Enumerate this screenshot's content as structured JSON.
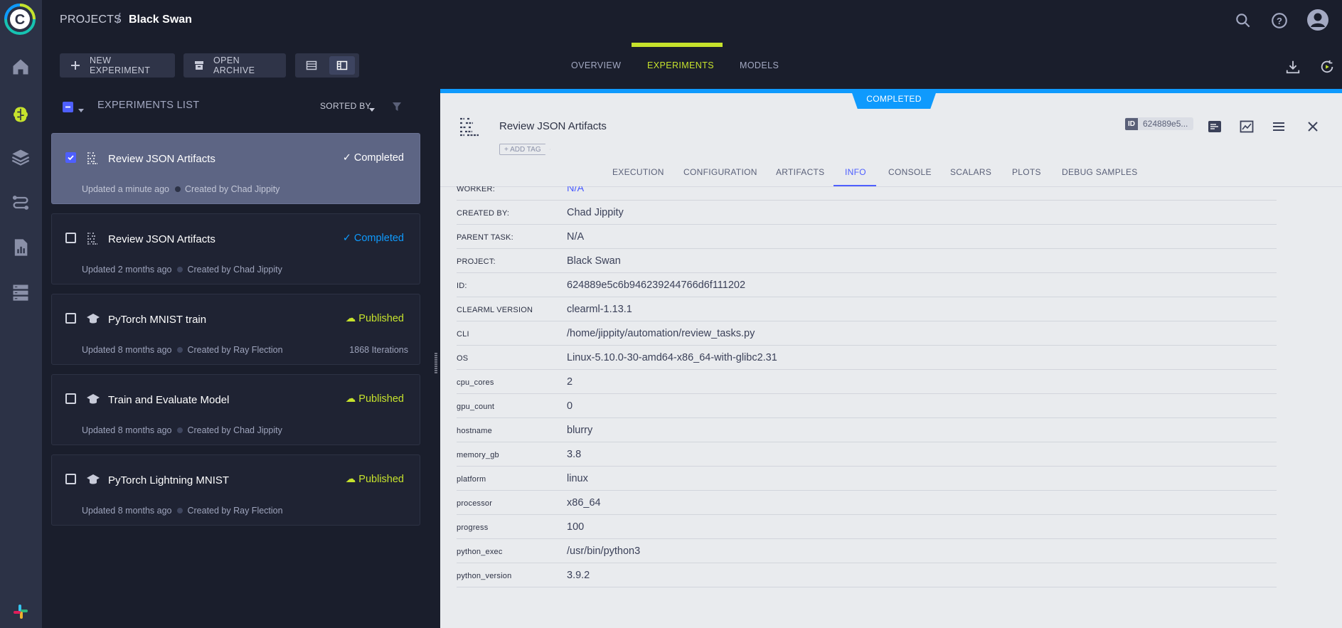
{
  "breadcrumb": {
    "projects": "PROJECTS",
    "separator": "/",
    "project": "Black Swan"
  },
  "toolbar": {
    "new_experiment": "NEW EXPERIMENT",
    "open_archive": "OPEN ARCHIVE"
  },
  "main_tabs": [
    {
      "label": "OVERVIEW",
      "active": false
    },
    {
      "label": "EXPERIMENTS",
      "active": true
    },
    {
      "label": "MODELS",
      "active": false
    }
  ],
  "list": {
    "title": "EXPERIMENTS LIST",
    "sorted_by": "SORTED BY",
    "items": [
      {
        "name": "Review JSON Artifacts",
        "status": "✓ Completed",
        "status_color": "#ffffff",
        "updated": "Updated a minute ago",
        "created": "Created by Chad Jippity",
        "iterations": "",
        "selected": true,
        "type": "data-processing"
      },
      {
        "name": "Review JSON Artifacts",
        "status": "✓ Completed",
        "status_color": "#0f9afd",
        "updated": "Updated 2 months ago",
        "created": "Created by Chad Jippity",
        "iterations": "",
        "selected": false,
        "type": "data-processing"
      },
      {
        "name": "PyTorch MNIST train",
        "status": "☁ Published",
        "status_color": "#c6e22c",
        "updated": "Updated 8 months ago",
        "created": "Created by Ray Flection",
        "iterations": "1868 Iterations",
        "selected": false,
        "type": "training"
      },
      {
        "name": "Train and Evaluate Model",
        "status": "☁ Published",
        "status_color": "#c6e22c",
        "updated": "Updated 8 months ago",
        "created": "Created by Chad Jippity",
        "iterations": "",
        "selected": false,
        "type": "training"
      },
      {
        "name": "PyTorch Lightning MNIST",
        "status": "☁ Published",
        "status_color": "#c6e22c",
        "updated": "Updated 8 months ago",
        "created": "Created by Ray Flection",
        "iterations": "",
        "selected": false,
        "type": "training"
      }
    ]
  },
  "details": {
    "status": "COMPLETED",
    "title": "Review JSON Artifacts",
    "add_tag": "+ ADD TAG",
    "id_label": "ID",
    "id_value": "624889e5...",
    "tabs": [
      {
        "label": "EXECUTION",
        "active": false
      },
      {
        "label": "CONFIGURATION",
        "active": false
      },
      {
        "label": "ARTIFACTS",
        "active": false
      },
      {
        "label": "INFO",
        "active": true
      },
      {
        "label": "CONSOLE",
        "active": false
      },
      {
        "label": "SCALARS",
        "active": false
      },
      {
        "label": "PLOTS",
        "active": false
      },
      {
        "label": "DEBUG SAMPLES",
        "active": false
      }
    ],
    "info": [
      {
        "key": "WORKER:",
        "value": "N/A"
      },
      {
        "key": "CREATED BY:",
        "value": "Chad Jippity"
      },
      {
        "key": "PARENT TASK:",
        "value": "N/A"
      },
      {
        "key": "PROJECT:",
        "value": "Black Swan"
      },
      {
        "key": "ID:",
        "value": "624889e5c6b946239244766d6f111202"
      },
      {
        "key": "CLEARML VERSION",
        "value": "clearml-1.13.1"
      },
      {
        "key": "CLI",
        "value": "/home/jippity/automation/review_tasks.py"
      },
      {
        "key": "OS",
        "value": "Linux-5.10.0-30-amd64-x86_64-with-glibc2.31"
      },
      {
        "key": "cpu_cores",
        "value": "2"
      },
      {
        "key": "gpu_count",
        "value": "0"
      },
      {
        "key": "hostname",
        "value": "blurry"
      },
      {
        "key": "memory_gb",
        "value": "3.8"
      },
      {
        "key": "platform",
        "value": "linux"
      },
      {
        "key": "processor",
        "value": "x86_64"
      },
      {
        "key": "progress",
        "value": "100"
      },
      {
        "key": "python_exec",
        "value": "/usr/bin/python3"
      },
      {
        "key": "python_version",
        "value": "3.9.2"
      }
    ]
  },
  "colors": {
    "accent": "#c6e22c",
    "completed": "#0f9afd",
    "primary": "#4e5ffe"
  },
  "icons": {
    "rail": [
      "home-icon",
      "brain-icon",
      "layers-icon",
      "pipelines-icon",
      "reports-icon",
      "datasets-icon",
      "slack-icon"
    ],
    "top": [
      "search-icon",
      "help-icon",
      "user-avatar-icon"
    ]
  }
}
